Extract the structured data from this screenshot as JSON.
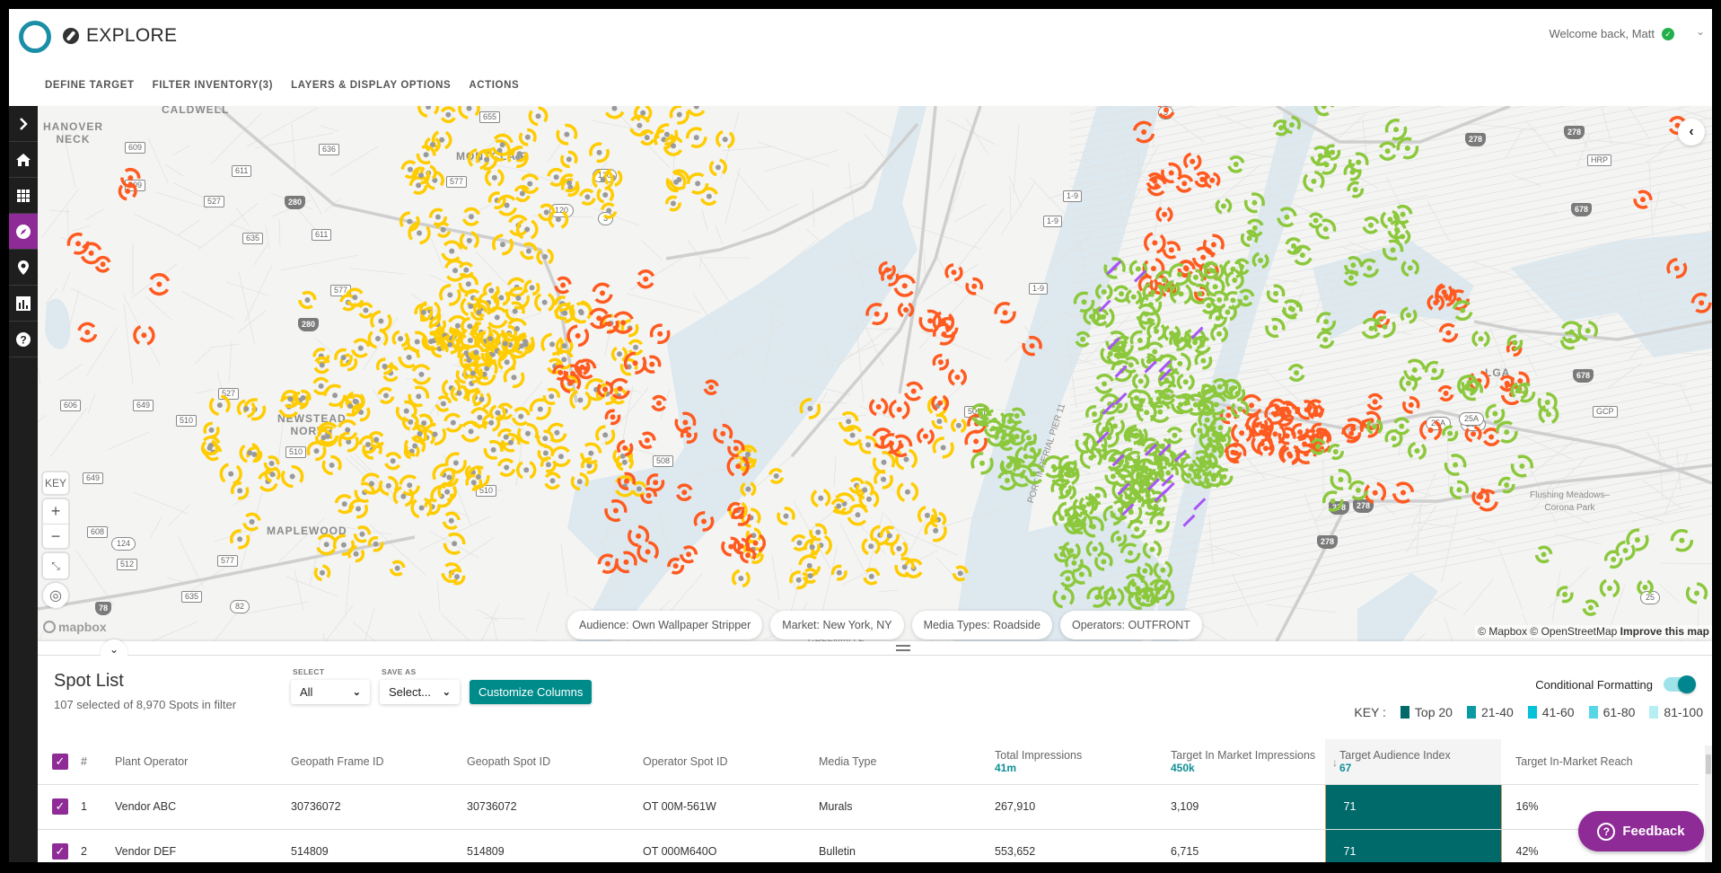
{
  "header": {
    "app_section": "EXPLORE",
    "welcome": "Welcome back, Matt",
    "nav": [
      "DEFINE TARGET",
      "FILTER INVENTORY(3)",
      "LAYERS & DISPLAY OPTIONS",
      "ACTIONS"
    ]
  },
  "sidebar": {
    "items": [
      {
        "name": "expand",
        "icon": "chevron-right-icon"
      },
      {
        "name": "home",
        "icon": "home-icon"
      },
      {
        "name": "apps",
        "icon": "grid-icon"
      },
      {
        "name": "explore",
        "icon": "compass-icon",
        "active": true
      },
      {
        "name": "places",
        "icon": "map-pin-icon"
      },
      {
        "name": "reports",
        "icon": "bar-chart-icon"
      },
      {
        "name": "help",
        "icon": "help-icon"
      }
    ]
  },
  "map": {
    "labels": {
      "caldwell": "CALDWELL",
      "hanover_neck": "HANOVER\nNECK",
      "montclair": "MONTCLAIR",
      "newstead_north": "NEWSTEAD\nNORTH",
      "maplewood": "MAPLEWOOD",
      "lga": "LGA",
      "flushing": "Flushing Meadows–\nCorona Park",
      "port_imperial": "PORT IMPERIAL PIER 11",
      "greenville": "GREENVILLE"
    },
    "shields": [
      "655",
      "609",
      "611",
      "636",
      "577",
      "609",
      "527",
      "280",
      "635",
      "611",
      "577",
      "280",
      "120",
      "3",
      "120",
      "1-9",
      "1-9",
      "1-9",
      "5",
      "606",
      "649",
      "527",
      "510",
      "510",
      "510",
      "508",
      "501",
      "649",
      "608",
      "124",
      "512",
      "78",
      "577",
      "635",
      "82",
      "278",
      "278",
      "HRP",
      "678",
      "678",
      "GCP",
      "25A",
      "25A",
      "25A",
      "278",
      "278",
      "278",
      "25"
    ],
    "key_label": "KEY",
    "zoom_in": "+",
    "zoom_out": "−",
    "mapbox_logo": "mapbox",
    "attribution": "© Mapbox © OpenStreetMap",
    "attribution_link": "Improve this map",
    "filter_pills": [
      "Audience: Own Wallpaper Stripper",
      "Market: New York, NY",
      "Media Types: Roadside",
      "Operators: OUTFRONT"
    ],
    "marker_colors": {
      "yellow": "#ffcc00",
      "orange": "#ff5a1f",
      "green": "#8cc83c",
      "purple": "#a855f7"
    }
  },
  "spot_list": {
    "title": "Spot List",
    "subtitle": "107 selected of 8,970 Spots in filter",
    "select_label": "SELECT",
    "select_value": "All",
    "save_as_label": "SAVE AS",
    "save_as_value": "Select...",
    "customize_button": "Customize Columns",
    "conditional_formatting": "Conditional Formatting",
    "conditional_formatting_on": true,
    "key_label": "KEY :",
    "key": [
      {
        "label": "Top 20",
        "color": "#006a6a"
      },
      {
        "label": "21-40",
        "color": "#0a9aa4"
      },
      {
        "label": "41-60",
        "color": "#00c2d8"
      },
      {
        "label": "61-80",
        "color": "#55d7e4"
      },
      {
        "label": "81-100",
        "color": "#b5eef3"
      }
    ],
    "columns": [
      {
        "label": "#"
      },
      {
        "label": "Plant Operator"
      },
      {
        "label": "Geopath Frame ID"
      },
      {
        "label": "Geopath Spot ID"
      },
      {
        "label": "Operator Spot ID"
      },
      {
        "label": "Media Type"
      },
      {
        "label": "Total Impressions",
        "sub": "41m"
      },
      {
        "label": "Target In Market Impressions",
        "sub": "450k"
      },
      {
        "label": "Target Audience Index",
        "sub": "67",
        "sorted": "desc"
      },
      {
        "label": "Target In-Market Reach"
      }
    ],
    "rows": [
      {
        "num": "1",
        "operator": "Vendor ABC",
        "frame_id": "30736072",
        "spot_id": "30736072",
        "op_spot_id": "OT 00M-561W",
        "media_type": "Murals",
        "total_imp": "267,910",
        "target_imp": "3,109",
        "index": "71",
        "reach": "16%"
      },
      {
        "num": "2",
        "operator": "Vendor DEF",
        "frame_id": "514809",
        "spot_id": "514809",
        "op_spot_id": "OT 000M640O",
        "media_type": "Bulletin",
        "total_imp": "553,652",
        "target_imp": "6,715",
        "index": "71",
        "reach": "42%"
      }
    ]
  },
  "feedback": {
    "label": "Feedback"
  }
}
